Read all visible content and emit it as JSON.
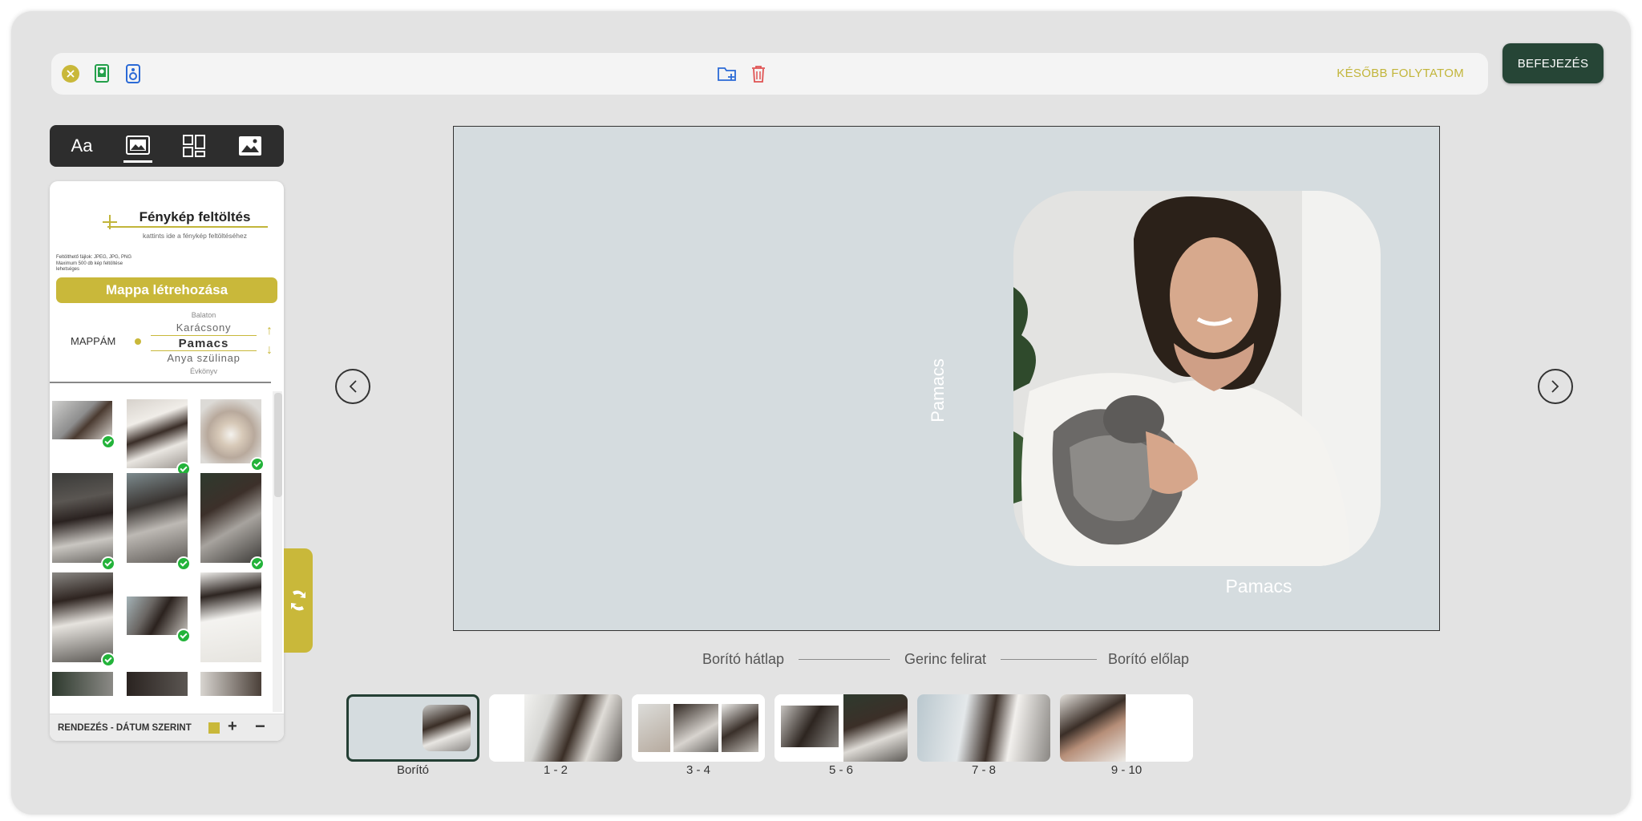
{
  "topbar": {
    "close_icon": "close-icon",
    "later_label": "KÉSŐBB FOLYTATOM",
    "finish_label": "BEFEJEZÉS"
  },
  "tools": [
    {
      "name": "text-tool",
      "label": "Aa"
    },
    {
      "name": "photos-tool"
    },
    {
      "name": "layouts-tool"
    },
    {
      "name": "backgrounds-tool"
    }
  ],
  "upload": {
    "title": "Fénykép feltöltés",
    "subtitle": "kattints ide a fénykép feltöltéséhez",
    "info_line1": "Feltölthető fájlok: JPEG, JPG, PNG",
    "info_line2": "Maximum 500 db kép feltöltése",
    "info_line3": "lehetséges"
  },
  "folders": {
    "create_label": "Mappa létrehozása",
    "my_folders_label": "MAPPÁM",
    "items": [
      "Balaton",
      "Karácsony",
      "Pamacs",
      "Anya szülinap",
      "Évkönyv"
    ],
    "selected": "Pamacs"
  },
  "sort": {
    "label": "RENDEZÉS - DÁTUM SZERINT"
  },
  "canvas": {
    "spine_text": "Pamacs",
    "cover_title": "Pamacs",
    "back_label": "Borító hátlap",
    "spine_label": "Gerinc felirat",
    "front_label": "Borító előlap"
  },
  "pages": [
    "Borító",
    "1 - 2",
    "3 - 4",
    "5 - 6",
    "7 - 8",
    "9 - 10"
  ],
  "colors": {
    "accent": "#c9b83a",
    "finish_bg": "#264536",
    "check": "#23b33a",
    "canvas_bg": "#d5dcdf"
  }
}
